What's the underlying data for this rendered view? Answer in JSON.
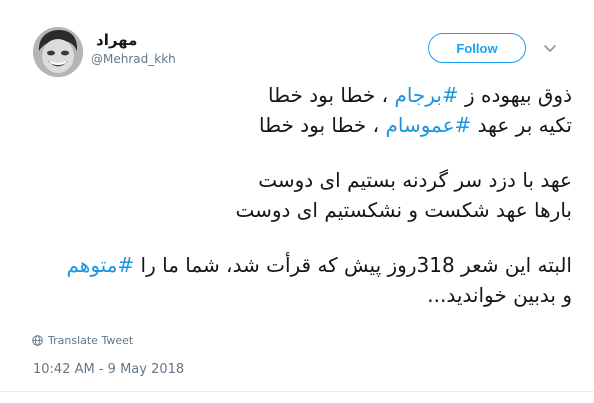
{
  "author": {
    "display_name": "مهراد",
    "handle": "@Mehrad_kkh"
  },
  "follow_button": {
    "label": "Follow"
  },
  "tweet": {
    "lines": [
      {
        "parts": [
          "ذوق بیهوده ز ",
          "#برجام",
          " ، خطا بود خطا"
        ]
      },
      {
        "parts": [
          "تکیه بر عهد ",
          "#عموسام",
          " ، خطا بود خطا"
        ]
      },
      {
        "text": "عهد با دزد سر گردنه بستیم ای دوست"
      },
      {
        "text": "بارها عهد شکست و نشکستیم ای دوست"
      },
      {
        "parts": [
          "البته این شعر 318روز پیش که قرأت شد، شما ما را ",
          "#متوهم"
        ]
      },
      {
        "text": "و بدبین خواندید..."
      }
    ]
  },
  "translate_link": "Translate Tweet",
  "timestamp": "10:42 AM - 9 May 2018",
  "icons": {
    "avatar": "avatar-photo",
    "more": "chevron-down-icon",
    "translate": "globe-icon"
  },
  "colors": {
    "accent": "#1da1f2",
    "hashtag": "#1b95e0",
    "secondary_text": "#657786",
    "primary_text": "#14171a"
  }
}
